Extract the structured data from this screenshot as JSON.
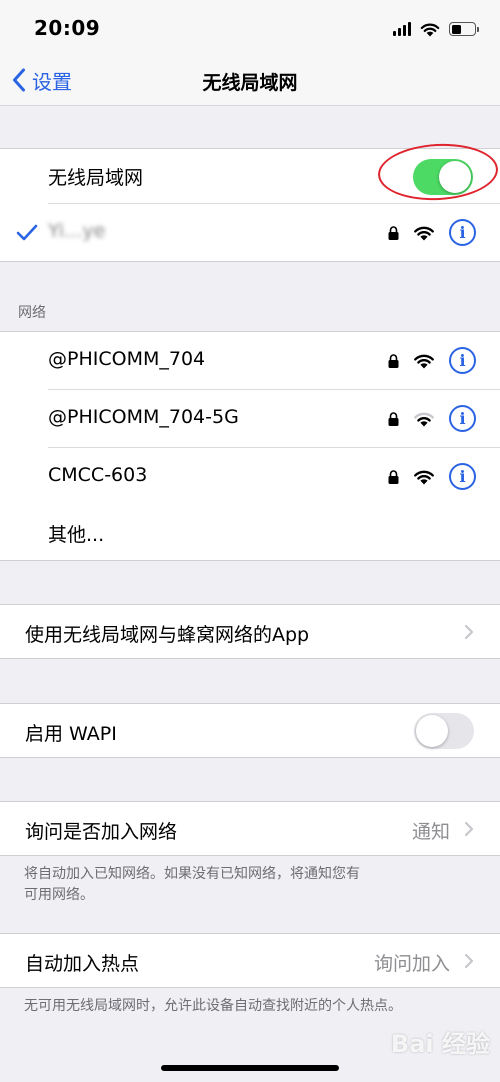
{
  "status_bar": {
    "time": "20:09"
  },
  "nav": {
    "back_label": "设置",
    "title": "无线局域网"
  },
  "wlan": {
    "label": "无线局域网",
    "enabled": true,
    "connected_ssid": "Yi...ye"
  },
  "networks": {
    "header": "网络",
    "items": [
      {
        "ssid": "@PHICOMM_704"
      },
      {
        "ssid": "@PHICOMM_704-5G"
      },
      {
        "ssid": "CMCC-603"
      }
    ],
    "other_label": "其他..."
  },
  "apps_row": {
    "label": "使用无线局域网与蜂窝网络的App"
  },
  "wapi": {
    "label": "启用 WAPI",
    "enabled": false
  },
  "ask_join": {
    "label": "询问是否加入网络",
    "value": "通知",
    "footnote_line1": "将自动加入已知网络。如果没有已知网络，将通知您有",
    "footnote_line2": "可用网络。"
  },
  "hotspot": {
    "label": "自动加入热点",
    "value": "询问加入",
    "footnote": "无可用无线局域网时，允许此设备自动查找附近的个人热点。"
  },
  "watermark": "Bai 经验",
  "colors": {
    "accent": "#2a63e3",
    "toggle_on": "#4cd964",
    "annotation": "#e0242e"
  }
}
